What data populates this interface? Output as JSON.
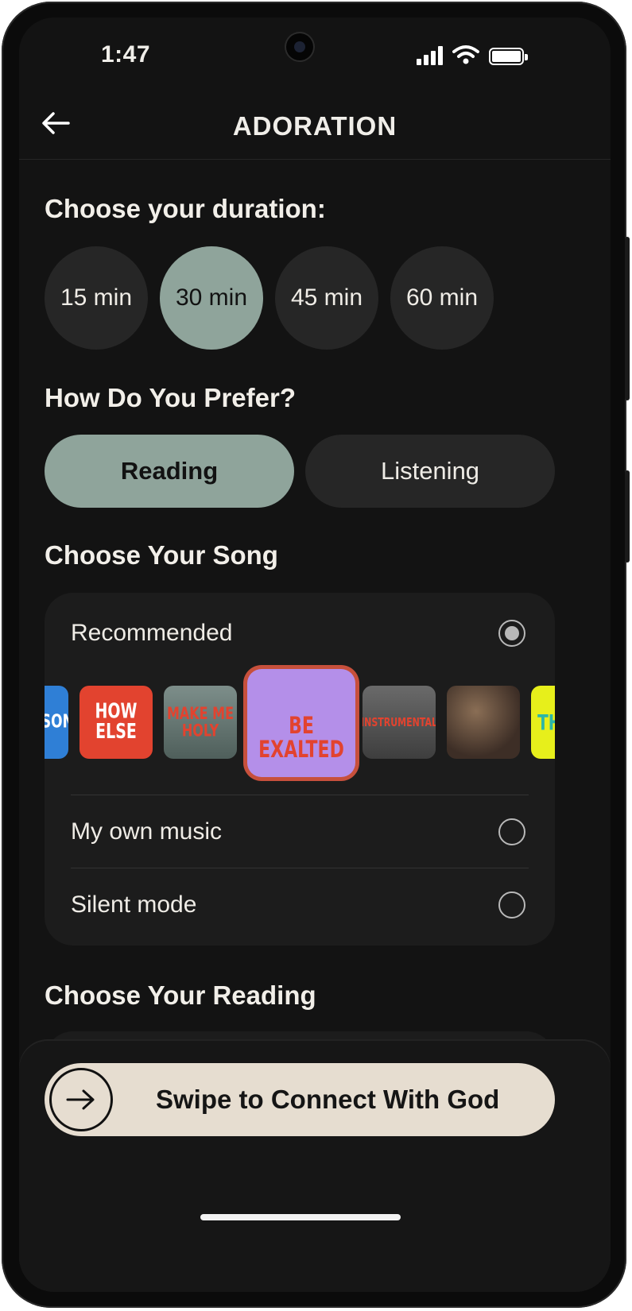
{
  "status": {
    "time": "1:47"
  },
  "header": {
    "title": "ADORATION"
  },
  "duration": {
    "title": "Choose your duration:",
    "options": [
      "15 min",
      "30 min",
      "45 min",
      "60 min"
    ],
    "selected": "30 min"
  },
  "preference": {
    "title": "How Do You Prefer?",
    "options": [
      "Reading",
      "Listening"
    ],
    "selected": "Reading"
  },
  "song": {
    "title": "Choose Your Song",
    "recommended_label": "Recommended",
    "own_music_label": "My own music",
    "silent_label": "Silent mode",
    "selected_option": "Recommended",
    "albums": [
      {
        "text": "EASON",
        "bg": "#2f7fd6",
        "fg": "#ffffff"
      },
      {
        "text": "HOW ELSE",
        "bg": "#e2432f",
        "fg": "#ffffff"
      },
      {
        "text": "MAKE ME HOLY",
        "bg": "#6d7f7a",
        "fg": "#e2432f"
      },
      {
        "text": "BE EXALTED",
        "bg": "#b48fe9",
        "fg": "#e2432f"
      },
      {
        "text": "INSTRUMENTAL",
        "bg": "#5a5a5a",
        "fg": "#e2432f"
      },
      {
        "text": "",
        "bg": "#4a3a30",
        "fg": "#ffffff"
      },
      {
        "text": "THA",
        "bg": "#e7ef1b",
        "fg": "#2bb6a8"
      }
    ],
    "selected_album": "BE EXALTED"
  },
  "reading": {
    "title": "Choose Your Reading"
  },
  "swipe": {
    "label": "Swipe to Connect With God"
  }
}
